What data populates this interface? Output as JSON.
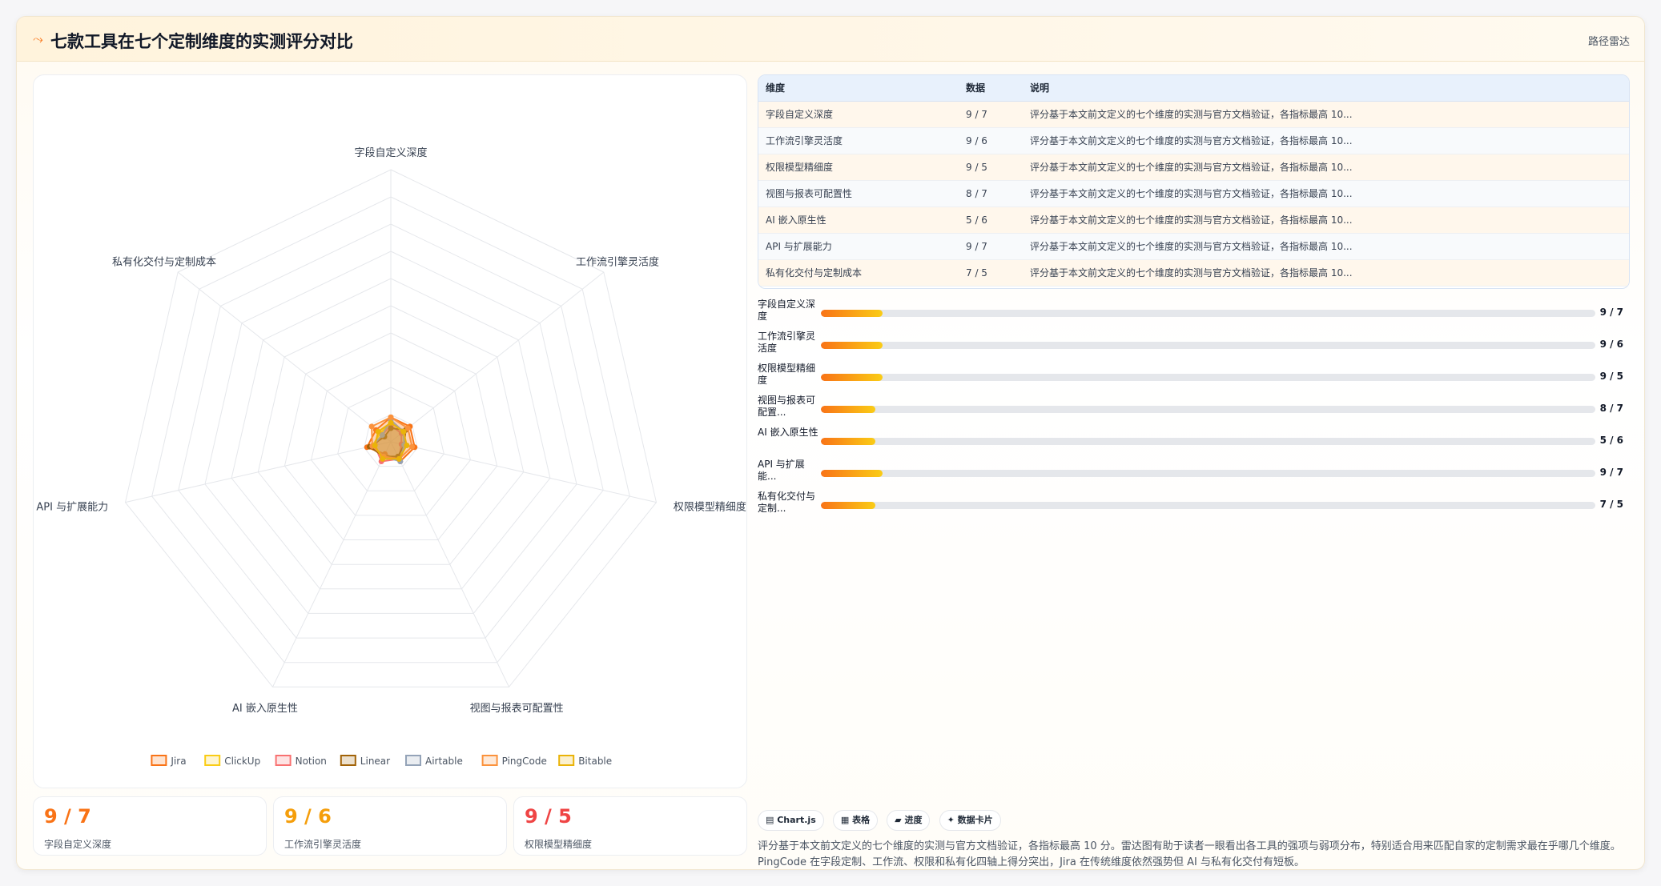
{
  "header": {
    "icon": "route-icon",
    "title": "七款工具在七个定制维度的实测评分对比",
    "right_label": "路径雷达"
  },
  "colors": {
    "accent": "#f97316",
    "accent_light": "#facc15",
    "stat_orange": "#f97316",
    "stat_amber": "#f59e0b",
    "stat_red": "#ef4444"
  },
  "chart_data": {
    "type": "radar",
    "axes": [
      "字段自定义深度",
      "工作流引擎灵活度",
      "权限模型精细度",
      "视图与报表可配置性",
      "AI 嵌入原生性",
      "API 与扩展能力",
      "私有化交付与定制成本"
    ],
    "rmax": 100,
    "grid": true,
    "legend_position": "bottom",
    "series": [
      {
        "name": "Jira",
        "color": "#f97316",
        "values": [
          9,
          9,
          9,
          8,
          5,
          9,
          7
        ]
      },
      {
        "name": "ClickUp",
        "color": "#facc15",
        "values": [
          7,
          6,
          5,
          7,
          6,
          7,
          5
        ]
      },
      {
        "name": "Notion",
        "color": "#f87171",
        "values": [
          6,
          5,
          4,
          7,
          8,
          6,
          4
        ]
      },
      {
        "name": "Linear",
        "color": "#a16207",
        "values": [
          5,
          7,
          5,
          6,
          6,
          8,
          3
        ]
      },
      {
        "name": "Airtable",
        "color": "#94a3b8",
        "values": [
          8,
          6,
          5,
          8,
          6,
          7,
          4
        ]
      },
      {
        "name": "PingCode",
        "color": "#fb923c",
        "values": [
          9,
          8,
          8,
          7,
          6,
          7,
          9
        ]
      },
      {
        "name": "Bitable",
        "color": "#eab308",
        "values": [
          7,
          6,
          6,
          7,
          7,
          6,
          6
        ]
      }
    ]
  },
  "stats": [
    {
      "value": "9 / 7",
      "label": "字段自定义深度"
    },
    {
      "value": "9 / 6",
      "label": "工作流引擎灵活度"
    },
    {
      "value": "9 / 5",
      "label": "权限模型精细度"
    }
  ],
  "table": {
    "headers": [
      "维度",
      "数据",
      "说明"
    ],
    "rows": [
      {
        "dim": "字段自定义深度",
        "data": "9 / 7",
        "note": "评分基于本文前文定义的七个维度的实测与官方文档验证，各指标最高 10..."
      },
      {
        "dim": "工作流引擎灵活度",
        "data": "9 / 6",
        "note": "评分基于本文前文定义的七个维度的实测与官方文档验证，各指标最高 10..."
      },
      {
        "dim": "权限模型精细度",
        "data": "9 / 5",
        "note": "评分基于本文前文定义的七个维度的实测与官方文档验证，各指标最高 10..."
      },
      {
        "dim": "视图与报表可配置性",
        "data": "8 / 7",
        "note": "评分基于本文前文定义的七个维度的实测与官方文档验证，各指标最高 10..."
      },
      {
        "dim": "AI 嵌入原生性",
        "data": "5 / 6",
        "note": "评分基于本文前文定义的七个维度的实测与官方文档验证，各指标最高 10..."
      },
      {
        "dim": "API 与扩展能力",
        "data": "9 / 7",
        "note": "评分基于本文前文定义的七个维度的实测与官方文档验证，各指标最高 10..."
      },
      {
        "dim": "私有化交付与定制成本",
        "data": "7 / 5",
        "note": "评分基于本文前文定义的七个维度的实测与官方文档验证，各指标最高 10..."
      }
    ]
  },
  "progress": [
    {
      "label": "字段自定义深度",
      "value": "9 / 7",
      "fill_percent": 8
    },
    {
      "label": "工作流引擎灵活度",
      "value": "9 / 6",
      "fill_percent": 8
    },
    {
      "label": "权限模型精细度",
      "value": "9 / 5",
      "fill_percent": 8
    },
    {
      "label": "视图与报表可配置...",
      "value": "8 / 7",
      "fill_percent": 7
    },
    {
      "label": "AI 嵌入原生性",
      "value": "5 / 6",
      "fill_percent": 7
    },
    {
      "label": "API 与扩展能...",
      "value": "9 / 7",
      "fill_percent": 8
    },
    {
      "label": "私有化交付与定制...",
      "value": "7 / 5",
      "fill_percent": 7
    }
  ],
  "chips": [
    {
      "icon": "chart-icon",
      "label": "Chart.js"
    },
    {
      "icon": "table-icon",
      "label": "表格"
    },
    {
      "icon": "progress-icon",
      "label": "进度"
    },
    {
      "icon": "sparkle-icon",
      "label": "数据卡片"
    }
  ],
  "description": {
    "line1": "评分基于本文前文定义的七个维度的实测与官方文档验证，各指标最高 10 分。雷达图有助于读者一眼看出各工具的强项与弱项分布，特别适合用来匹配自家的定制需求最在乎哪几个维度。",
    "line2": "PingCode 在字段定制、工作流、权限和私有化四轴上得分突出，Jira 在传统维度依然强势但 AI 与私有化交付有短板。"
  }
}
